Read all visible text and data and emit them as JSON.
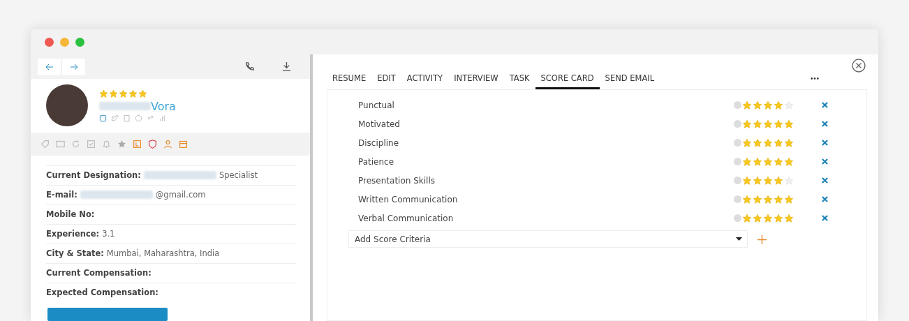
{
  "candidate": {
    "stars": 5,
    "last_name": "Vora"
  },
  "details": [
    {
      "label": "Current Designation:",
      "value": "Specialist",
      "redacted": true
    },
    {
      "label": "E-mail:",
      "value": "@gmail.com",
      "redacted": true
    },
    {
      "label": "Mobile No:",
      "redacted": false
    },
    {
      "label": "Experience:",
      "value": "3.1",
      "redacted": false
    },
    {
      "label": "City & State:",
      "value": "Mumbai, Maharashtra, India",
      "redacted": false
    },
    {
      "label": "Current Compensation:",
      "redacted": false
    },
    {
      "label": "Expected Compensation:",
      "redacted": false
    }
  ],
  "tabs": [
    {
      "label": "RESUME",
      "selected": false
    },
    {
      "label": "EDIT",
      "selected": false
    },
    {
      "label": "ACTIVITY",
      "selected": false
    },
    {
      "label": "INTERVIEW",
      "selected": false
    },
    {
      "label": "TASK",
      "selected": false
    },
    {
      "label": "SCORE CARD",
      "selected": true
    },
    {
      "label": "SEND EMAIL",
      "selected": false
    }
  ],
  "more_menu": "• • •",
  "criteria": [
    {
      "name": "Punctual",
      "stars": 4
    },
    {
      "name": "Motivated",
      "stars": 5
    },
    {
      "name": "Discipline",
      "stars": 5
    },
    {
      "name": "Patience",
      "stars": 5
    },
    {
      "name": "Presentation Skills",
      "stars": 4
    },
    {
      "name": "Written Communication",
      "stars": 5
    },
    {
      "name": "Verbal Communication",
      "stars": 5
    }
  ],
  "add_criteria": {
    "placeholder": "Add Score Criteria"
  }
}
